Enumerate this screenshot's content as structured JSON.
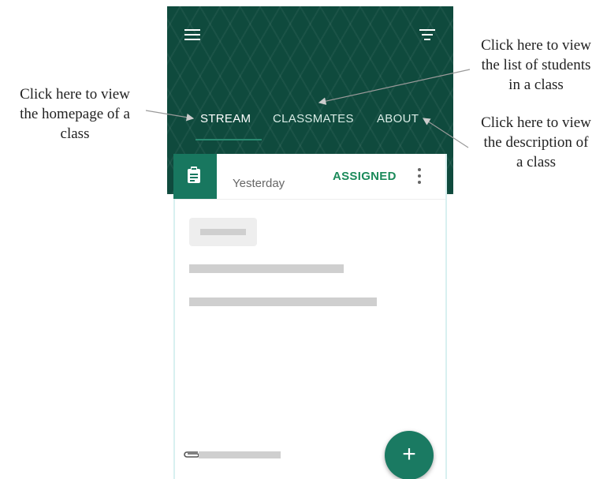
{
  "annotations": {
    "homepage": "Click here to view the homepage of a class",
    "homepage_lines": [
      "Click here to view",
      "the homepage of a",
      "class"
    ],
    "classmates_lines": [
      "Click here to view",
      "the list of students",
      "in a class"
    ],
    "about_lines": [
      "Click here to view",
      "the description of",
      "a class"
    ]
  },
  "header": {
    "menu_icon": "menu-icon",
    "filter_icon": "filter-icon",
    "background_color": "#0f4a3d"
  },
  "tabs": [
    {
      "label": "STREAM",
      "active": true
    },
    {
      "label": "CLASSMATES",
      "active": false
    },
    {
      "label": "ABOUT",
      "active": false
    }
  ],
  "card": {
    "badge_icon": "assignment-icon",
    "date": "Yesterday",
    "status": "ASSIGNED",
    "status_color": "#1b8a5a",
    "more_icon": "more-vert-icon",
    "attachment_icon": "paperclip-icon"
  },
  "fab": {
    "label": "+",
    "color": "#1a7a62"
  }
}
